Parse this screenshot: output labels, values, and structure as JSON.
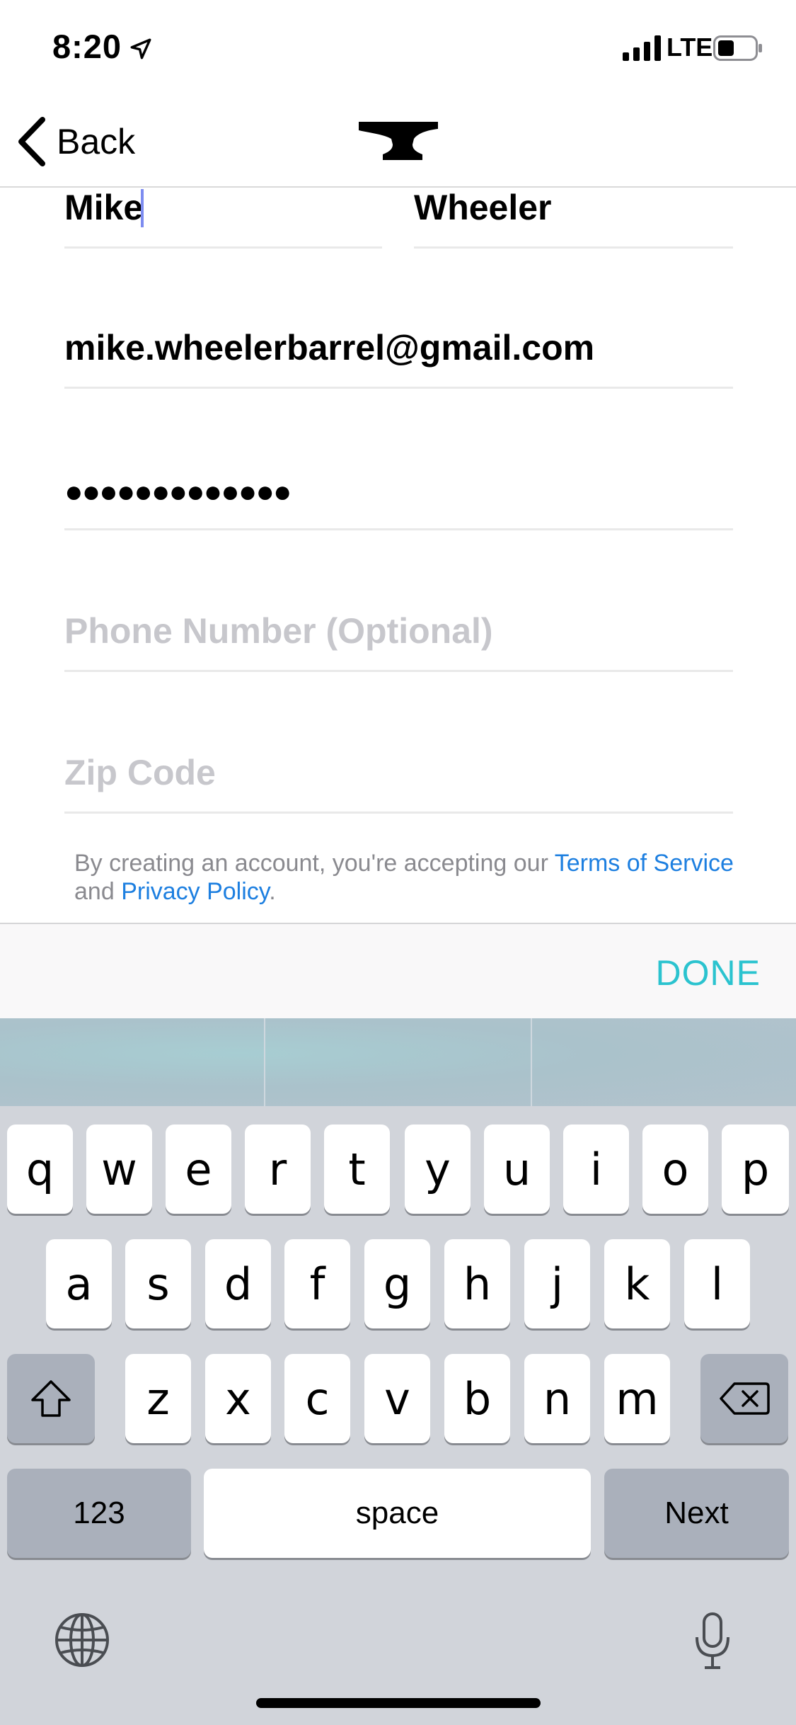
{
  "status_bar": {
    "time": "8:20",
    "network": "LTE",
    "location_icon": "location-arrow-icon",
    "signal_icon": "cellular-signal-icon",
    "battery_icon": "battery-icon"
  },
  "nav": {
    "back_label": "Back",
    "back_icon": "chevron-left-icon",
    "logo_icon": "anvil-logo-icon"
  },
  "form": {
    "first_name": "Mike",
    "last_name": "Wheeler",
    "email": "mike.wheelerbarrel@gmail.com",
    "password_masked": "●●●●●●●●●●●●●",
    "phone_placeholder": "Phone Number (Optional)",
    "zip_placeholder": "Zip Code"
  },
  "terms": {
    "prefix": "By creating an account, you're accepting our ",
    "terms_link": "Terms of Service",
    "middle": " and ",
    "privacy_link": "Privacy Policy",
    "suffix": "."
  },
  "accessory": {
    "done_label": "DONE"
  },
  "keyboard": {
    "row1": [
      "q",
      "w",
      "e",
      "r",
      "t",
      "y",
      "u",
      "i",
      "o",
      "p"
    ],
    "row2": [
      "a",
      "s",
      "d",
      "f",
      "g",
      "h",
      "j",
      "k",
      "l"
    ],
    "row3": [
      "z",
      "x",
      "c",
      "v",
      "b",
      "n",
      "m"
    ],
    "numbers_label": "123",
    "space_label": "space",
    "return_label": "Next",
    "shift_icon": "shift-icon",
    "delete_icon": "delete-backspace-icon",
    "globe_icon": "globe-icon",
    "mic_icon": "microphone-icon"
  },
  "colors": {
    "accent_done": "#2bc3cf",
    "link": "#1d7fe0",
    "caret": "#7d8cf0",
    "keyboard_bg": "#d1d4da"
  }
}
